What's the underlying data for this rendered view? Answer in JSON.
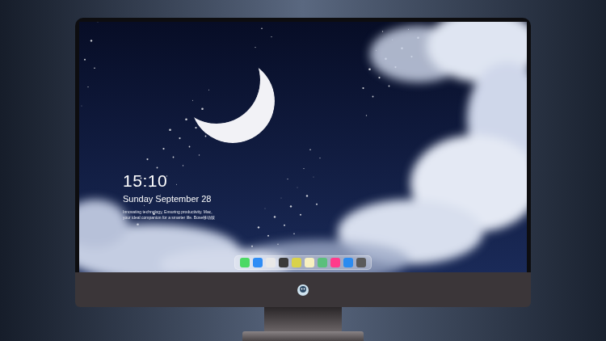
{
  "desktop": {
    "clock": {
      "time": "15:10",
      "date": "Sunday September 28",
      "slogan": "Innovating technology, Ensuring productivity. Mac, your ideal companion for a smarter life. Bose移动版"
    }
  },
  "dock": {
    "items": [
      {
        "color": "#4cd964"
      },
      {
        "color": "#2f8df5"
      },
      {
        "color": "#e8e8e8"
      },
      {
        "color": "#3a3a3a"
      },
      {
        "color": "#d9d24a"
      },
      {
        "color": "#f7f0c0"
      },
      {
        "color": "#5bbf7b"
      },
      {
        "color": "#ff3b8b"
      },
      {
        "color": "#2b8bf0"
      },
      {
        "color": "#5a5a5a"
      }
    ]
  }
}
